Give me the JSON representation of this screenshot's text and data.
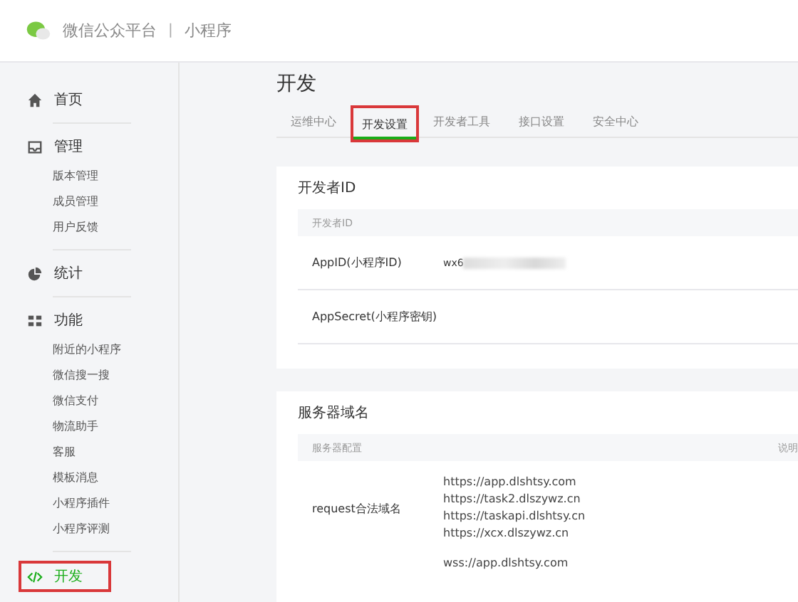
{
  "header": {
    "platform": "微信公众平台",
    "separator": "|",
    "product": "小程序"
  },
  "nav": [
    {
      "label": "首页",
      "selected": false,
      "highlighted": false
    },
    {
      "label": "管理",
      "selected": false,
      "highlighted": false,
      "children": [
        {
          "label": "版本管理"
        },
        {
          "label": "成员管理"
        },
        {
          "label": "用户反馈"
        }
      ]
    },
    {
      "label": "统计",
      "selected": false,
      "highlighted": false
    },
    {
      "label": "功能",
      "selected": false,
      "highlighted": false,
      "children": [
        {
          "label": "附近的小程序"
        },
        {
          "label": "微信搜一搜"
        },
        {
          "label": "微信支付"
        },
        {
          "label": "物流助手"
        },
        {
          "label": "客服"
        },
        {
          "label": "模板消息"
        },
        {
          "label": "小程序插件"
        },
        {
          "label": "小程序评测"
        }
      ]
    },
    {
      "label": "开发",
      "selected": true,
      "highlighted": true
    }
  ],
  "page_title": "开发",
  "tabs": [
    {
      "label": "运维中心",
      "selected": false,
      "highlighted": false
    },
    {
      "label": "开发设置",
      "selected": true,
      "highlighted": true
    },
    {
      "label": "开发者工具",
      "selected": false,
      "highlighted": false
    },
    {
      "label": "接口设置",
      "selected": false,
      "highlighted": false
    },
    {
      "label": "安全中心",
      "selected": false,
      "highlighted": false
    }
  ],
  "developer_id": {
    "title": "开发者ID",
    "header": "开发者ID",
    "rows": [
      {
        "label": "AppID(小程序ID)",
        "value": "wx6",
        "blurred": true
      },
      {
        "label": "AppSecret(小程序密钥)",
        "blurred": false
      }
    ]
  },
  "server_domains": {
    "title": "服务器域名",
    "header": "服务器配置",
    "header_2": "说明",
    "rows": [
      {
        "label": "request合法域名",
        "values": [
          "https://app.dlshtsy.com",
          "https://task2.dlszywz.cn",
          "https://taskapi.dlshtsy.cn",
          "https://xcx.dlszywz.cn"
        ]
      },
      {
        "values": [
          "wss://app.dlshtsy.com"
        ]
      }
    ]
  }
}
